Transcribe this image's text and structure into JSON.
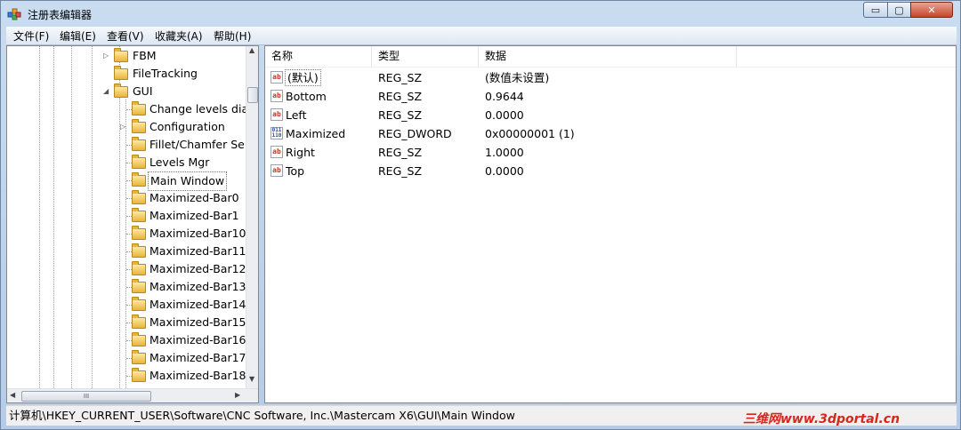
{
  "window": {
    "title": "注册表编辑器",
    "controls": {
      "minimize": "▭",
      "maximize": "▢",
      "close": "✕"
    }
  },
  "menu": [
    "文件(F)",
    "编辑(E)",
    "查看(V)",
    "收藏夹(A)",
    "帮助(H)"
  ],
  "tree": {
    "items": [
      {
        "label": "FBM",
        "level": 0,
        "expander": "▷"
      },
      {
        "label": "FileTracking",
        "level": 0,
        "expander": ""
      },
      {
        "label": "GUI",
        "level": 0,
        "expander": "◢"
      },
      {
        "label": "Change levels dial",
        "level": 1,
        "expander": ""
      },
      {
        "label": "Configuration",
        "level": 1,
        "expander": "▷"
      },
      {
        "label": "Fillet/Chamfer Sele",
        "level": 1,
        "expander": ""
      },
      {
        "label": "Levels Mgr",
        "level": 1,
        "expander": ""
      },
      {
        "label": "Main Window",
        "level": 1,
        "expander": "",
        "selected": true
      },
      {
        "label": "Maximized-Bar0",
        "level": 1,
        "expander": ""
      },
      {
        "label": "Maximized-Bar1",
        "level": 1,
        "expander": ""
      },
      {
        "label": "Maximized-Bar10",
        "level": 1,
        "expander": ""
      },
      {
        "label": "Maximized-Bar11",
        "level": 1,
        "expander": ""
      },
      {
        "label": "Maximized-Bar12",
        "level": 1,
        "expander": ""
      },
      {
        "label": "Maximized-Bar13",
        "level": 1,
        "expander": ""
      },
      {
        "label": "Maximized-Bar14",
        "level": 1,
        "expander": ""
      },
      {
        "label": "Maximized-Bar15",
        "level": 1,
        "expander": ""
      },
      {
        "label": "Maximized-Bar16",
        "level": 1,
        "expander": ""
      },
      {
        "label": "Maximized-Bar17",
        "level": 1,
        "expander": ""
      },
      {
        "label": "Maximized-Bar18",
        "level": 1,
        "expander": ""
      }
    ],
    "scroll_up": "▲",
    "scroll_down": "▼",
    "scroll_left": "◀",
    "scroll_right": "▶",
    "hscroll_grip": "III"
  },
  "list": {
    "columns": [
      "名称",
      "类型",
      "数据"
    ],
    "rows": [
      {
        "icon": "ab",
        "name": "(默认)",
        "type": "REG_SZ",
        "data": "(数值未设置)",
        "selected": true
      },
      {
        "icon": "ab",
        "name": "Bottom",
        "type": "REG_SZ",
        "data": "0.9644"
      },
      {
        "icon": "ab",
        "name": "Left",
        "type": "REG_SZ",
        "data": "0.0000"
      },
      {
        "icon": "binary",
        "name": "Maximized",
        "type": "REG_DWORD",
        "data": "0x00000001 (1)"
      },
      {
        "icon": "ab",
        "name": "Right",
        "type": "REG_SZ",
        "data": "1.0000"
      },
      {
        "icon": "ab",
        "name": "Top",
        "type": "REG_SZ",
        "data": "0.0000"
      }
    ]
  },
  "status": {
    "path": "计算机\\HKEY_CURRENT_USER\\Software\\CNC Software, Inc.\\Mastercam X6\\GUI\\Main Window"
  },
  "watermark": "三维网www.3dportal.cn"
}
